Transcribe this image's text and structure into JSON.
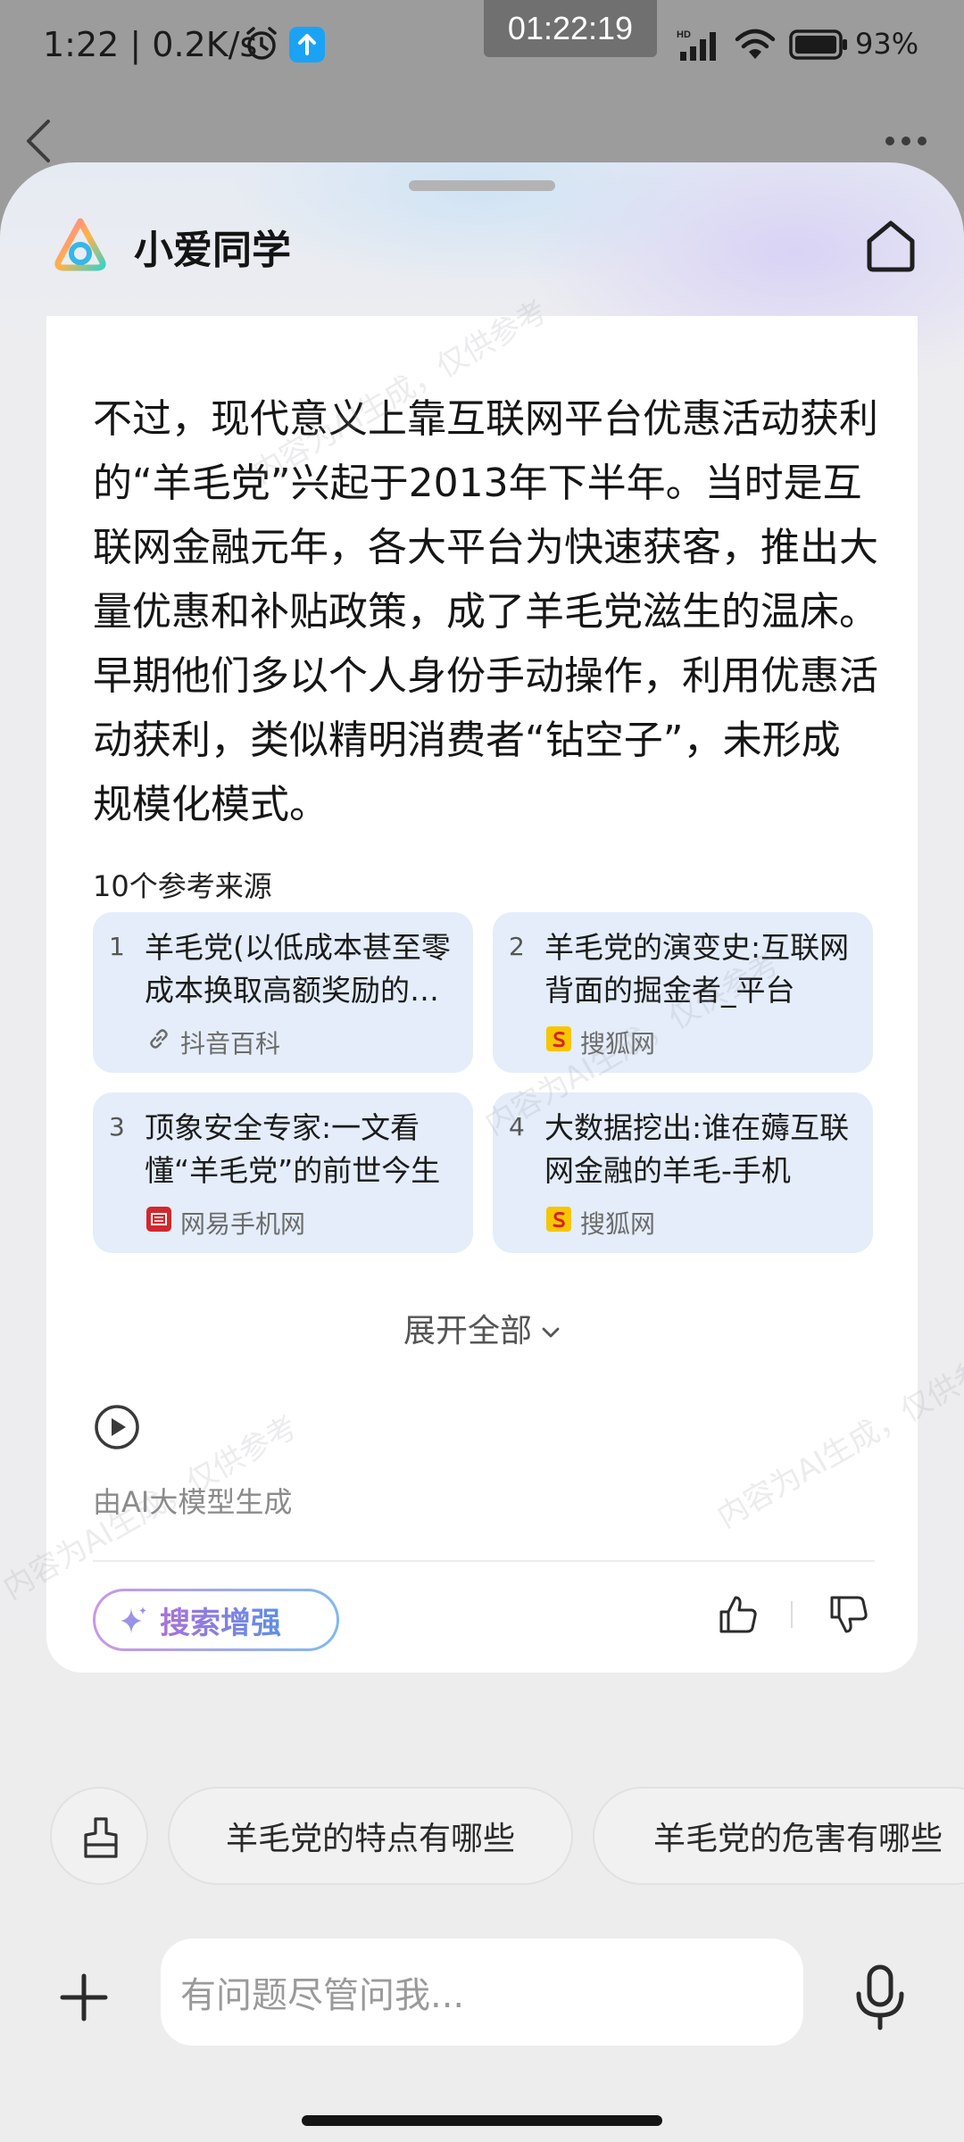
{
  "status_bar": {
    "time": "1:22 | 0.2K/s",
    "clock": "01:22:19",
    "battery": "93%"
  },
  "assistant": {
    "title": "小爱同学"
  },
  "answer": {
    "text": "不过，现代意义上靠互联网平台优惠活动获利的“羊毛党”兴起于2013年下半年。当时是互联网金融元年，各大平台为快速获客，推出大量优惠和补贴政策，成了羊毛党滋生的温床。早期他们多以个人身份手动操作，利用优惠活动获利，类似精明消费者“钻空子”，未形成规模化模式。"
  },
  "sources": {
    "heading": "10个参考来源",
    "items": [
      {
        "num": "1",
        "title": "羊毛党(以低成本甚至零成本换取高额奖励的人群)",
        "site": "抖音百科",
        "icon": "link-icon"
      },
      {
        "num": "2",
        "title": "羊毛党的演变史:互联网背面的掘金者_平台",
        "site": "搜狐网",
        "icon": "sohu-icon"
      },
      {
        "num": "3",
        "title": "顶象安全专家:一文看懂“羊毛党”的前世今生",
        "site": "网易手机网",
        "icon": "netease-icon"
      },
      {
        "num": "4",
        "title": "大数据挖出:谁在薅互联网金融的羊毛-手机",
        "site": "搜狐网",
        "icon": "sohu-icon"
      }
    ],
    "expand_label": "展开全部"
  },
  "ai_note": "由AI大模型生成",
  "search_enhance_label": "搜索增强",
  "suggestions": [
    "羊毛党的特点有哪些",
    "羊毛党的危害有哪些"
  ],
  "input": {
    "placeholder": "有问题尽管问我..."
  },
  "watermark": "内容为AI生成，仅供参考",
  "colors": {
    "source_card_bg": "#e4edf9",
    "accent_gradient_start": "#c997e6",
    "accent_gradient_end": "#7fb8ef"
  }
}
